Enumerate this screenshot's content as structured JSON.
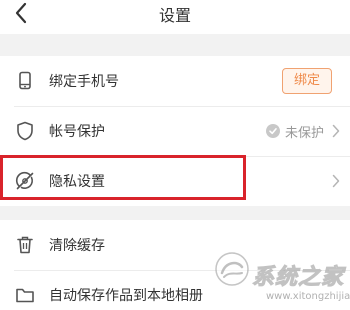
{
  "nav": {
    "title": "设置",
    "back_icon": "back-chevron-icon"
  },
  "groups": [
    {
      "items": [
        {
          "label": "绑定手机号",
          "icon": "phone-icon",
          "button_label": "绑定"
        },
        {
          "label": "帐号保护",
          "icon": "shield-icon",
          "status": "未保护",
          "status_icon": "check-circle-icon"
        },
        {
          "label": "隐私设置",
          "icon": "privacy-icon",
          "highlighted": true
        }
      ]
    },
    {
      "items": [
        {
          "label": "清除缓存",
          "icon": "trash-icon"
        },
        {
          "label": "自动保存作品到本地相册",
          "icon": "folder-icon"
        }
      ]
    }
  ],
  "watermark": {
    "text": "系统之家",
    "url": "www.xitongzhijia.net"
  },
  "colors": {
    "accent": "#ef8a4a",
    "highlight": "#d9232b",
    "text_primary": "#333333",
    "text_secondary": "#999999",
    "background": "#f2f2f2"
  }
}
